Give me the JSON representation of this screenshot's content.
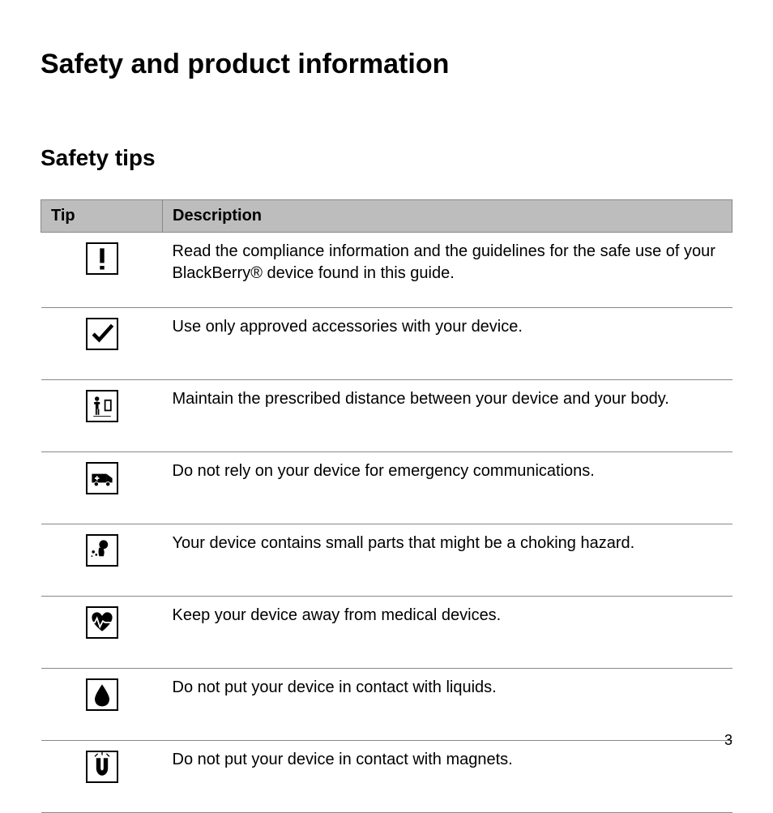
{
  "heading": "Safety and product information",
  "subheading": "Safety tips",
  "table": {
    "headers": {
      "tip": "Tip",
      "description": "Description"
    },
    "rows": [
      {
        "icon": "exclamation-icon",
        "description": "Read the compliance information and the guidelines for the safe use of your BlackBerry® device found in this guide."
      },
      {
        "icon": "checkmark-icon",
        "description": "Use only approved accessories with your device."
      },
      {
        "icon": "person-distance-icon",
        "description": "Maintain the prescribed distance between your device and your body."
      },
      {
        "icon": "ambulance-icon",
        "description": "Do not rely on your device for emergency communications."
      },
      {
        "icon": "choking-hazard-icon",
        "description": "Your device contains small parts that might be a choking hazard."
      },
      {
        "icon": "heart-monitor-icon",
        "description": "Keep your device away from medical devices."
      },
      {
        "icon": "liquid-drop-icon",
        "description": "Do not put your device in contact with liquids."
      },
      {
        "icon": "magnet-icon",
        "description": "Do not put your device in contact with magnets."
      }
    ]
  },
  "page_number": "3"
}
